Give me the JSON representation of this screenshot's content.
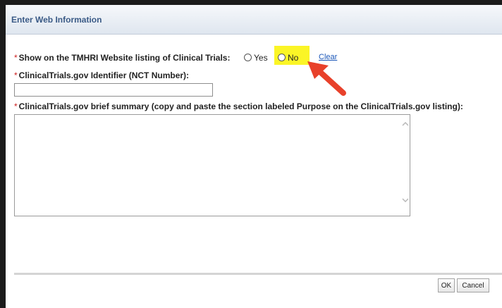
{
  "dialog": {
    "title": "Enter Web Information"
  },
  "required_marker": "*",
  "show_on_website": {
    "label": "Show on the TMHRI Website listing of Clinical Trials:",
    "options": [
      "Yes",
      "No"
    ],
    "selected": null,
    "clear_label": "Clear",
    "highlight_color": "#fbf526"
  },
  "nct_number": {
    "label": "ClinicalTrials.gov Identifier (NCT Number):",
    "value": ""
  },
  "brief_summary": {
    "label": "ClinicalTrials.gov brief summary (copy and paste the section labeled Purpose on the ClinicalTrials.gov listing):",
    "value": ""
  },
  "annotation": {
    "arrow_color": "#e8412b"
  },
  "footer": {
    "ok_label": "OK",
    "cancel_label": "Cancel"
  },
  "colors": {
    "title_text": "#3a5a86",
    "required": "#cc1f1f",
    "link": "#1a56b8"
  }
}
